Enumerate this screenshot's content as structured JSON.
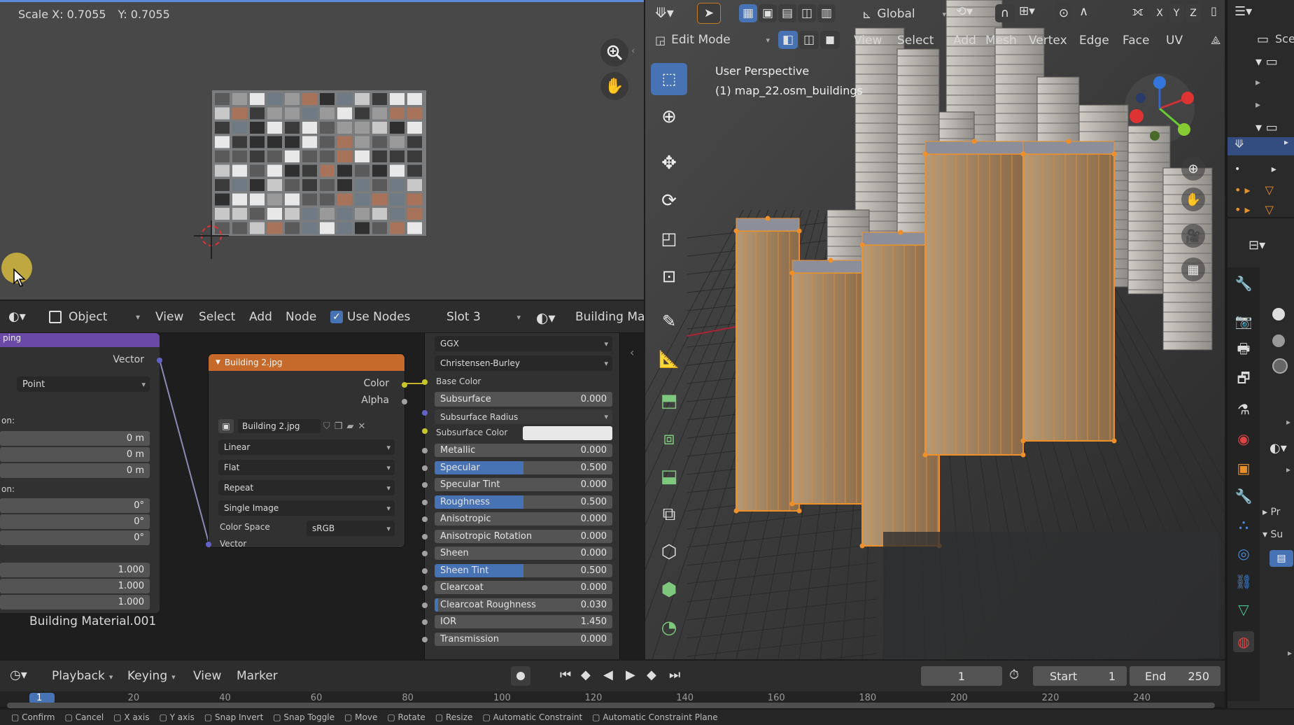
{
  "image_editor": {
    "scale_label": "Scale X: 0.7055",
    "scale_y": "Y: 0.7055"
  },
  "node_header": {
    "mode": "Object",
    "menus": [
      "View",
      "Select",
      "Add",
      "Node"
    ],
    "use_nodes_label": "Use Nodes",
    "slot": "Slot 3",
    "material": "Building Ma"
  },
  "mapping_node": {
    "title": "ping",
    "vector_label": "Vector",
    "type": "Point",
    "location_label": "on:",
    "location": [
      "0 m",
      "0 m",
      "0 m"
    ],
    "rotation_label": "on:",
    "rotation": [
      "0°",
      "0°",
      "0°"
    ],
    "scale": [
      "1.000",
      "1.000",
      "1.000"
    ],
    "material_name": "Building Material.001"
  },
  "image_node": {
    "title": "Building 2.jpg",
    "out_color": "Color",
    "out_alpha": "Alpha",
    "image_name": "Building 2.jpg",
    "interpolation": "Linear",
    "projection": "Flat",
    "extension": "Repeat",
    "source": "Single Image",
    "colorspace_label": "Color Space",
    "colorspace": "sRGB",
    "in_vector": "Vector"
  },
  "bsdf_node": {
    "distribution": "GGX",
    "subsurface_method": "Christensen-Burley",
    "base_color_label": "Base Color",
    "subsurface_color_label": "Subsurface Color",
    "subsurface_radius_label": "Subsurface Radius",
    "fields": [
      {
        "label": "Subsurface",
        "value": "0.000",
        "fill": 0.0
      },
      {
        "label": "Metallic",
        "value": "0.000",
        "fill": 0.0
      },
      {
        "label": "Specular",
        "value": "0.500",
        "fill": 0.5
      },
      {
        "label": "Specular Tint",
        "value": "0.000",
        "fill": 0.0
      },
      {
        "label": "Roughness",
        "value": "0.500",
        "fill": 0.5
      },
      {
        "label": "Anisotropic",
        "value": "0.000",
        "fill": 0.0
      },
      {
        "label": "Anisotropic Rotation",
        "value": "0.000",
        "fill": 0.0
      },
      {
        "label": "Sheen",
        "value": "0.000",
        "fill": 0.0
      },
      {
        "label": "Sheen Tint",
        "value": "0.500",
        "fill": 0.5
      },
      {
        "label": "Clearcoat",
        "value": "0.000",
        "fill": 0.0
      },
      {
        "label": "Clearcoat Roughness",
        "value": "0.030",
        "fill": 0.03
      },
      {
        "label": "IOR",
        "value": "1.450",
        "fill": 0.0
      },
      {
        "label": "Transmission",
        "value": "0.000",
        "fill": 0.0
      }
    ]
  },
  "viewport": {
    "transform_orient": "Global",
    "mode": "Edit Mode",
    "menus": [
      "View",
      "Select",
      "Add",
      "Mesh",
      "Vertex",
      "Edge",
      "Face",
      "UV"
    ],
    "perspective": "User Perspective",
    "object_info": "(1) map_22.osm_buildings",
    "axes": [
      "X",
      "Y",
      "Z"
    ]
  },
  "timeline": {
    "menus": [
      "Playback",
      "Keying",
      "View",
      "Marker"
    ],
    "current_frame": "1",
    "start_label": "Start",
    "start": "1",
    "end_label": "End",
    "end": "250",
    "ticks": [
      "1",
      "20",
      "40",
      "60",
      "80",
      "100",
      "120",
      "140",
      "160",
      "180",
      "200",
      "220",
      "240"
    ]
  },
  "statusbar": {
    "items": [
      "Confirm",
      "Cancel",
      "X axis",
      "Y axis",
      "Snap Invert",
      "Snap Toggle",
      "Move",
      "Rotate",
      "Resize",
      "Automatic Constraint",
      "Automatic Constraint Plane"
    ]
  },
  "properties": {
    "scene_label": "Sce",
    "partial_labels": [
      "Pr",
      "Su"
    ]
  },
  "colors": {
    "accent": "#4772b3",
    "node_header_texture": "#c56a2a",
    "node_header_vector": "#6a4aa6",
    "selection": "#f0902a"
  }
}
